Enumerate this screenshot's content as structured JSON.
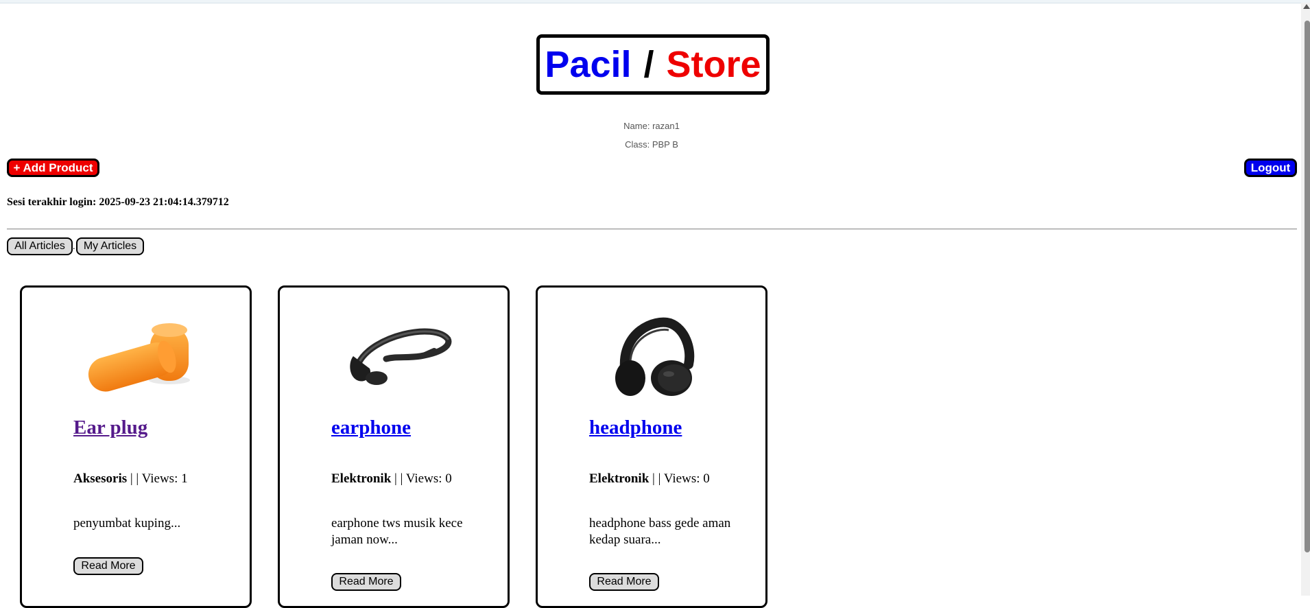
{
  "header": {
    "title_part1": "Pacil",
    "title_separator": "/",
    "title_part2": "Store",
    "name_line": "Name: razan1",
    "class_line": "Class: PBP B"
  },
  "actions": {
    "add_product_label": "+ Add Product",
    "logout_label": "Logout"
  },
  "session": {
    "last_login_text": "Sesi terakhir login: 2025-09-23 21:04:14.379712"
  },
  "filters": {
    "all_label": "All Articles",
    "separator": ".",
    "mine_label": "My Articles"
  },
  "products": [
    {
      "name": "Ear plug",
      "category": "Aksesoris",
      "meta_separator": "| |",
      "views": "Views: 1",
      "description": "penyumbat kuping...",
      "read_more_label": "Read More",
      "image_icon": "earplug-image"
    },
    {
      "name": "earphone",
      "category": "Elektronik",
      "meta_separator": "| |",
      "views": "Views: 0",
      "description": "earphone tws musik kece jaman now...",
      "read_more_label": "Read More",
      "image_icon": "earphone-image"
    },
    {
      "name": "headphone",
      "category": "Elektronik",
      "meta_separator": "| |",
      "views": "Views: 0",
      "description": "headphone bass gede aman kedap suara...",
      "read_more_label": "Read More",
      "image_icon": "headphone-image"
    }
  ],
  "colors": {
    "title_blue": "#0000ee",
    "title_red": "#ee0000",
    "add_button": "#ee0000",
    "logout_button": "#0000ee",
    "visited_link": "#551a8b"
  }
}
